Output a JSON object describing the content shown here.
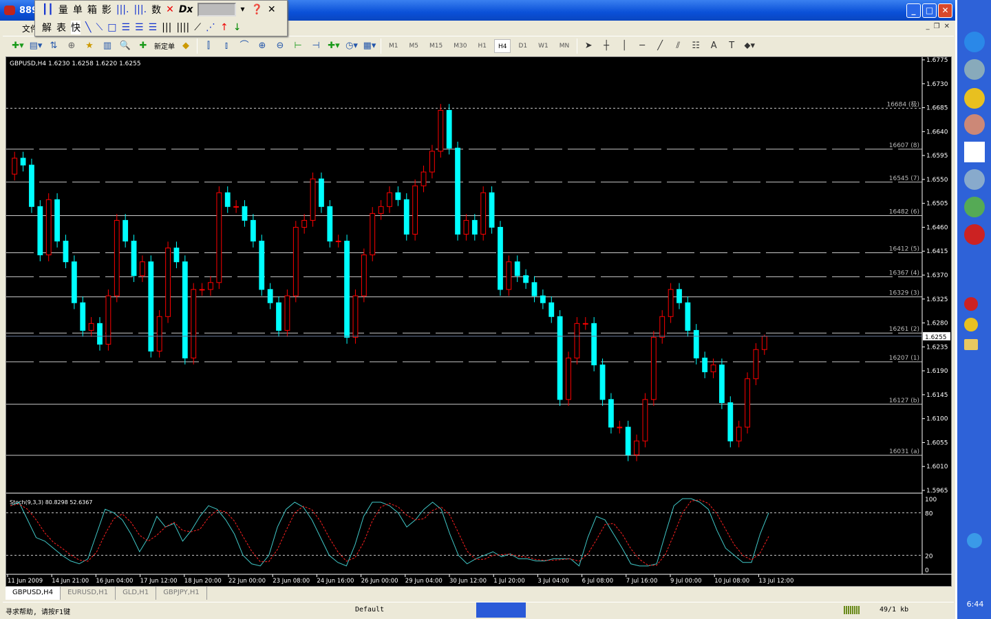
{
  "window": {
    "title": "889",
    "buttons": [
      "_",
      "□",
      "✕"
    ]
  },
  "menu": {
    "first": "文件"
  },
  "floating_toolbar": {
    "row1": [
      "量",
      "单",
      "箱",
      "影",
      "数"
    ],
    "row2": [
      "解",
      "表",
      "快"
    ]
  },
  "toolbar": {
    "new_order": "新定单",
    "timeframes": [
      "M1",
      "M5",
      "M15",
      "M30",
      "H1",
      "H4",
      "D1",
      "W1",
      "MN"
    ],
    "active_timeframe": "H4"
  },
  "chart": {
    "header": "GBPUSD,H4  1.6230 1.6258 1.6220 1.6255",
    "current_price": "1.6255",
    "price_labels": [
      "1.6775",
      "1.6730",
      "1.6685",
      "1.6640",
      "1.6595",
      "1.6550",
      "1.6505",
      "1.6460",
      "1.6415",
      "1.6370",
      "1.6325",
      "1.6280",
      "1.6235",
      "1.6190",
      "1.6145",
      "1.6100",
      "1.6055",
      "1.6010",
      "1.5965"
    ],
    "time_labels": [
      "11 Jun 2009",
      "14 Jun 21:00",
      "16 Jun 04:00",
      "17 Jun 12:00",
      "18 Jun 20:00",
      "22 Jun 00:00",
      "23 Jun 08:00",
      "24 Jun 16:00",
      "26 Jun 00:00",
      "29 Jun 04:00",
      "30 Jun 12:00",
      "1 Jul 20:00",
      "3 Jul 04:00",
      "6 Jul 08:00",
      "7 Jul 16:00",
      "9 Jul 00:00",
      "10 Jul 08:00",
      "13 Jul 12:00"
    ],
    "levels": [
      {
        "price": 1.6684,
        "label": "16684 (极)",
        "style": "dotted"
      },
      {
        "price": 1.6607,
        "label": "16607 (8)",
        "style": "dashed"
      },
      {
        "price": 1.6545,
        "label": "16545 (7)",
        "style": "dashed"
      },
      {
        "price": 1.6482,
        "label": "16482 (6)",
        "style": "solid"
      },
      {
        "price": 1.6412,
        "label": "16412 (5)",
        "style": "dashed"
      },
      {
        "price": 1.6367,
        "label": "16367 (4)",
        "style": "dashed"
      },
      {
        "price": 1.6329,
        "label": "16329 (3)",
        "style": "solid"
      },
      {
        "price": 1.6261,
        "label": "16261 (2)",
        "style": "dashed"
      },
      {
        "price": 1.6207,
        "label": "16207 (1)",
        "style": "dashed"
      },
      {
        "price": 1.6127,
        "label": "16127 (b)",
        "style": "solid"
      },
      {
        "price": 1.6031,
        "label": "16031 (a)",
        "style": "solid"
      }
    ]
  },
  "chart_data": {
    "type": "candlestick",
    "symbol": "GBPUSD",
    "timeframe": "H4",
    "ylim": [
      1.5965,
      1.6775
    ],
    "first_open": 1.656,
    "last_candle": {
      "open": 1.623,
      "high": 1.6258,
      "low": 1.622,
      "close": 1.6255
    },
    "closes": [
      1.659,
      1.6577,
      1.6499,
      1.6408,
      1.6512,
      1.6434,
      1.6395,
      1.6318,
      1.6266,
      1.6279,
      1.624,
      1.6331,
      1.6473,
      1.6434,
      1.6369,
      1.6395,
      1.6227,
      1.6292,
      1.6421,
      1.6395,
      1.6214,
      1.6343,
      1.6343,
      1.6356,
      1.6525,
      1.6499,
      1.6499,
      1.6473,
      1.6434,
      1.6343,
      1.6318,
      1.6266,
      1.6331,
      1.646,
      1.6473,
      1.6551,
      1.6499,
      1.6434,
      1.6434,
      1.6253,
      1.6331,
      1.6408,
      1.6486,
      1.6499,
      1.6525,
      1.6512,
      1.6447,
      1.6538,
      1.6564,
      1.6603,
      1.668,
      1.6609,
      1.6447,
      1.6473,
      1.6447,
      1.6525,
      1.646,
      1.6343,
      1.6395,
      1.6369,
      1.6356,
      1.6331,
      1.6318,
      1.6292,
      1.6136,
      1.6214,
      1.6279,
      1.6279,
      1.6201,
      1.6136,
      1.6084,
      1.6084,
      1.6032,
      1.6058,
      1.6136,
      1.6253,
      1.6292,
      1.6343,
      1.6318,
      1.6266,
      1.6214,
      1.6188,
      1.6201,
      1.613,
      1.6058,
      1.6084,
      1.6175,
      1.623,
      1.6255
    ],
    "up_color": "#ff0000",
    "down_color": "#00ffff",
    "indicator": {
      "label": "Stoch(9,3,3) 80.8298 52.6367",
      "ylim": [
        0,
        100
      ],
      "levels": [
        20,
        80
      ],
      "axis_labels": [
        "100",
        "80",
        "20",
        "0"
      ],
      "k_color": "#40c8c8",
      "d_color": "#ff2020",
      "k": [
        90,
        95,
        70,
        45,
        40,
        30,
        20,
        12,
        8,
        15,
        50,
        85,
        80,
        70,
        50,
        25,
        45,
        75,
        60,
        65,
        40,
        55,
        75,
        90,
        85,
        70,
        50,
        20,
        8,
        5,
        20,
        60,
        85,
        95,
        88,
        70,
        45,
        20,
        10,
        5,
        35,
        75,
        95,
        95,
        90,
        80,
        60,
        70,
        85,
        95,
        85,
        50,
        20,
        8,
        15,
        20,
        25,
        18,
        22,
        15,
        15,
        12,
        12,
        15,
        15,
        15,
        5,
        45,
        75,
        70,
        50,
        30,
        8,
        5,
        5,
        8,
        50,
        90,
        100,
        100,
        95,
        85,
        55,
        30,
        20,
        10,
        10,
        50,
        80
      ]
    }
  },
  "tabs": [
    "GBPUSD,H4",
    "EURUSD,H1",
    "GLD,H1",
    "GBPJPY,H1"
  ],
  "status": {
    "help": "寻求帮助, 请按F1键",
    "profile": "Default",
    "traffic": "49/1 kb"
  },
  "taskbar": {
    "clock": "6:44"
  }
}
